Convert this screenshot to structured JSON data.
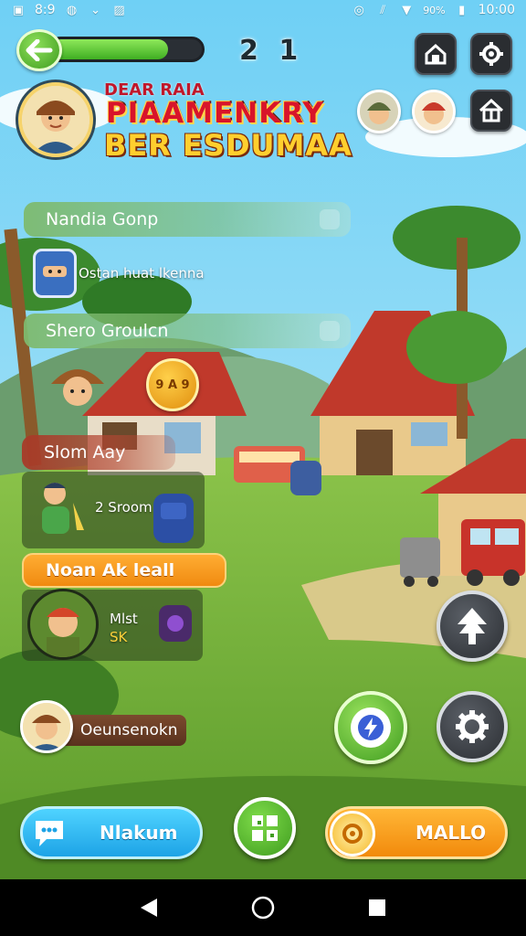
{
  "status_bar": {
    "time_left": "8:9",
    "battery": "90%",
    "time_right": "10:00",
    "icons_left": [
      "app-icon",
      "refresh-icon",
      "chevron-down-icon",
      "image-icon"
    ],
    "icons_right": [
      "alarm-icon",
      "signal-icon",
      "wifi-icon"
    ]
  },
  "hud": {
    "progress": 0.78,
    "level": "2 1",
    "colors": {
      "progress_fill": "#4fc22a",
      "progress_track": "#2a2f35",
      "accent_green": "#3f9c1f"
    }
  },
  "title": {
    "line1": "DEAR RAIA",
    "line2": "PIAAMENKRY",
    "line3": "BER ESDUMAA"
  },
  "panels": {
    "nandia_group": {
      "label": "Nandia Gonp"
    },
    "row_ostan": {
      "text": "Ostan huat lkenna"
    },
    "shero_group": {
      "label": "Shero Groulcn"
    },
    "coin": {
      "text": "9 A 9"
    },
    "slom": {
      "label": "Slom Aay"
    },
    "row_groom": {
      "text": "2 Sroom"
    },
    "noan": {
      "label": "Noan Ak leall"
    },
    "mini_card": {
      "line1": "Mlst",
      "line2": "SK"
    }
  },
  "user_chip": {
    "name": "Oeunsenokn"
  },
  "bottom_bar": {
    "chat_button": "Nlakum",
    "mallo_button": "MALLO"
  }
}
